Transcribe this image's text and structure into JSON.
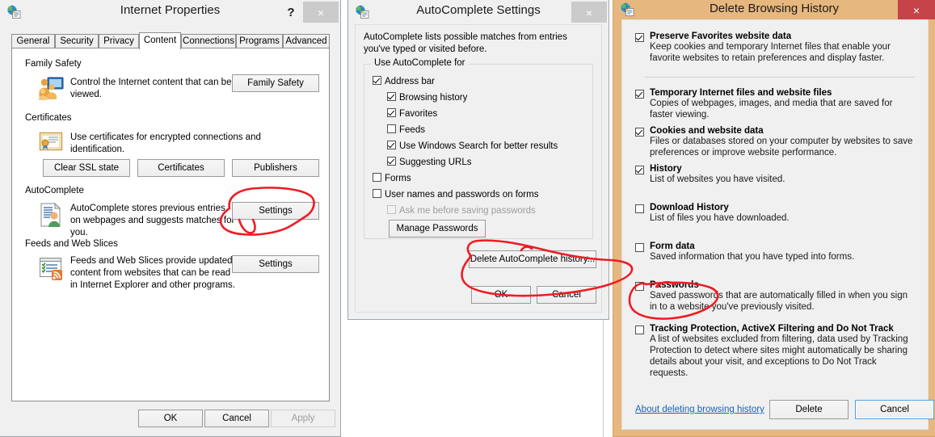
{
  "internet_properties": {
    "title": "Internet Properties",
    "icon": "globe-page-icon",
    "help_label": "?",
    "close_label": "×",
    "tabs": [
      {
        "label": "General",
        "selected": false
      },
      {
        "label": "Security",
        "selected": false
      },
      {
        "label": "Privacy",
        "selected": false
      },
      {
        "label": "Content",
        "selected": true
      },
      {
        "label": "Connections",
        "selected": false
      },
      {
        "label": "Programs",
        "selected": false
      },
      {
        "label": "Advanced",
        "selected": false
      }
    ],
    "groups": {
      "family_safety": {
        "title": "Family Safety",
        "icon": "family-safety-icon",
        "description": "Control the Internet content that can be viewed.",
        "button": "Family Safety"
      },
      "certificates": {
        "title": "Certificates",
        "icon": "certificate-icon",
        "description": "Use certificates for encrypted connections and identification.",
        "buttons": [
          "Clear SSL state",
          "Certificates",
          "Publishers"
        ]
      },
      "autocomplete": {
        "title": "AutoComplete",
        "icon": "autocomplete-icon",
        "description": "AutoComplete stores previous entries on webpages and suggests matches for you.",
        "button": "Settings"
      },
      "feeds": {
        "title": "Feeds and Web Slices",
        "icon": "feeds-icon",
        "description": "Feeds and Web Slices provide updated content from websites that can be read in Internet Explorer and other programs.",
        "button": "Settings"
      }
    },
    "footer": {
      "ok": "OK",
      "cancel": "Cancel",
      "apply": "Apply",
      "apply_disabled": true
    }
  },
  "autocomplete_settings": {
    "title": "AutoComplete Settings",
    "icon": "globe-page-icon",
    "close_label": "×",
    "intro": "AutoComplete lists possible matches from entries you've typed or visited before.",
    "fieldset_legend": "Use AutoComplete for",
    "options": [
      {
        "label": "Address bar",
        "checked": true,
        "indent": 0,
        "disabled": false
      },
      {
        "label": "Browsing history",
        "checked": true,
        "indent": 1,
        "disabled": false
      },
      {
        "label": "Favorites",
        "checked": true,
        "indent": 1,
        "disabled": false
      },
      {
        "label": "Feeds",
        "checked": false,
        "indent": 1,
        "disabled": false
      },
      {
        "label": "Use Windows Search for better results",
        "checked": true,
        "indent": 1,
        "disabled": false
      },
      {
        "label": "Suggesting URLs",
        "checked": true,
        "indent": 1,
        "disabled": false
      },
      {
        "label": "Forms",
        "checked": false,
        "indent": 0,
        "disabled": false
      },
      {
        "label": "User names and passwords on forms",
        "checked": false,
        "indent": 0,
        "disabled": false
      },
      {
        "label": "Ask me before saving passwords",
        "checked": false,
        "indent": 1,
        "disabled": true
      }
    ],
    "manage_passwords": "Manage Passwords",
    "delete_history": "Delete AutoComplete history...",
    "ok": "OK",
    "cancel": "Cancel"
  },
  "delete_browsing_history": {
    "title": "Delete Browsing History",
    "icon": "globe-page-icon",
    "close_label": "×",
    "accent_color": "#e6b77e",
    "close_color": "#c7434a",
    "items": [
      {
        "label": "Preserve Favorites website data",
        "checked": true,
        "description": "Keep cookies and temporary Internet files that enable your favorite websites to retain preferences and display faster."
      },
      {
        "label": "Temporary Internet files and website files",
        "checked": true,
        "description": "Copies of webpages, images, and media that are saved for faster viewing."
      },
      {
        "label": "Cookies and website data",
        "checked": true,
        "description": "Files or databases stored on your computer by websites to save preferences or improve website performance."
      },
      {
        "label": "History",
        "checked": true,
        "description": "List of websites you have visited."
      },
      {
        "label": "Download History",
        "checked": false,
        "description": "List of files you have downloaded."
      },
      {
        "label": "Form data",
        "checked": false,
        "description": "Saved information that you have typed into forms."
      },
      {
        "label": "Passwords",
        "checked": false,
        "description": "Saved passwords that are automatically filled in when you sign in to a website you've previously visited."
      },
      {
        "label": "Tracking Protection, ActiveX Filtering and Do Not Track",
        "checked": false,
        "description": "A list of websites excluded from filtering, data used by Tracking Protection to detect where sites might automatically be sharing details about your visit, and exceptions to Do Not Track requests."
      }
    ],
    "about_link": "About deleting browsing history",
    "delete": "Delete",
    "cancel": "Cancel"
  },
  "annotations": {
    "color": "#ee1c24",
    "marks": [
      {
        "name": "circle-autocomplete-settings-button",
        "target": "Settings"
      },
      {
        "name": "circle-delete-autocomplete-history-button",
        "target": "Delete AutoComplete history..."
      },
      {
        "name": "circle-passwords-checkbox",
        "target": "Passwords"
      }
    ]
  }
}
